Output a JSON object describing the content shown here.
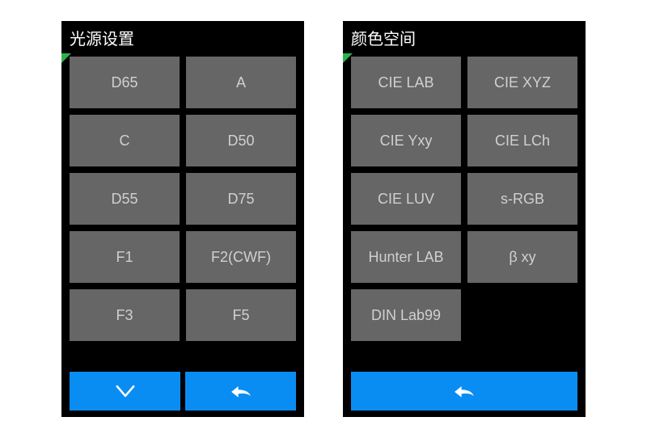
{
  "left": {
    "title": "光源设置",
    "items": [
      "D65",
      "A",
      "C",
      "D50",
      "D55",
      "D75",
      "F1",
      "F2(CWF)",
      "F3",
      "F5"
    ],
    "buttons": [
      "down",
      "back"
    ]
  },
  "right": {
    "title": "颜色空间",
    "items": [
      "CIE LAB",
      "CIE XYZ",
      "CIE Yxy",
      "CIE LCh",
      "CIE LUV",
      "s-RGB",
      "Hunter LAB",
      "β xy",
      "DIN Lab99"
    ],
    "buttons": [
      "back"
    ]
  },
  "colors": {
    "accent": "#0a8df2",
    "corner": "#2bb24c",
    "item_bg": "#666666"
  }
}
